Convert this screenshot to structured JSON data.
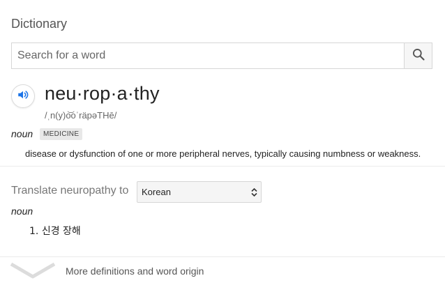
{
  "header": {
    "title": "Dictionary"
  },
  "search": {
    "placeholder": "Search for a word",
    "value": "",
    "button_icon": "search-icon"
  },
  "entry": {
    "audio_icon": "speaker-icon",
    "word": "neu·rop·a·thy",
    "phonetic": "/ˌn(y)o͝oˈräpəTHē/",
    "part_of_speech": "noun",
    "label": "MEDICINE",
    "definition": "disease or dysfunction of one or more peripheral nerves, typically causing numbness or weakness."
  },
  "translate": {
    "label": "Translate neuropathy to",
    "selected_language": "Korean",
    "part_of_speech": "noun",
    "results": [
      {
        "number": "1.",
        "text": "신경 장해"
      }
    ]
  },
  "footer": {
    "more_label": "More definitions and word origin",
    "chevron_icon": "chevron-down-icon"
  },
  "colors": {
    "accent_blue": "#1a73e8",
    "divider": "#ebebeb",
    "badge_bg": "#e8e8e8"
  }
}
